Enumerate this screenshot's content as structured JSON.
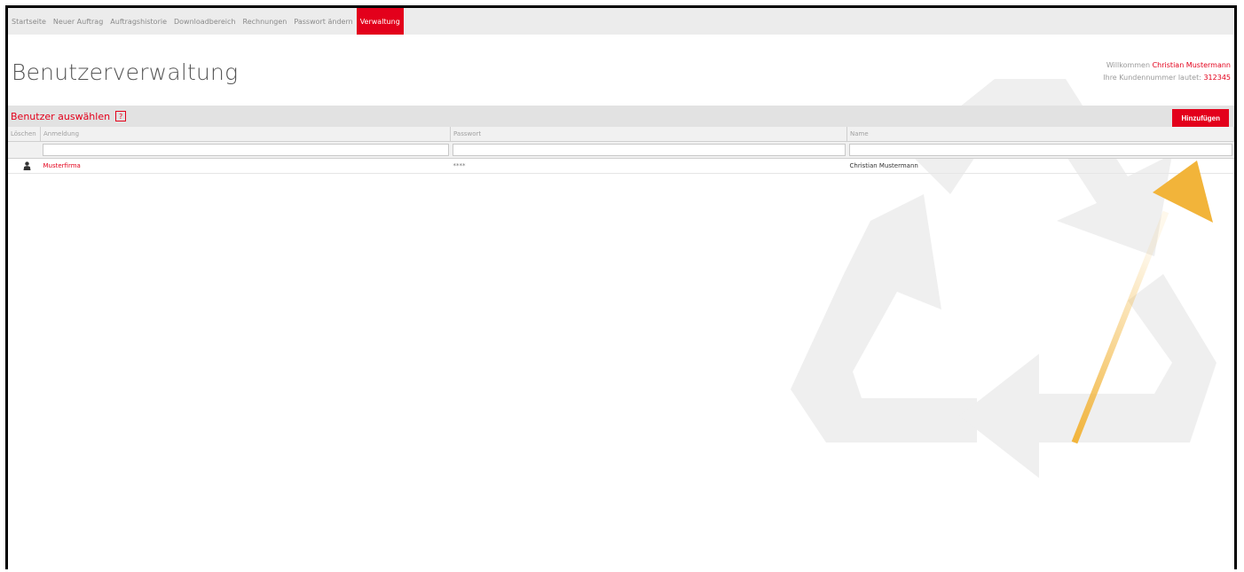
{
  "nav": {
    "items": [
      {
        "label": "Startseite"
      },
      {
        "label": "Neuer Auftrag"
      },
      {
        "label": "Auftragshistorie"
      },
      {
        "label": "Downloadbereich"
      },
      {
        "label": "Rechnungen"
      },
      {
        "label": "Passwort ändern"
      },
      {
        "label": "Verwaltung"
      }
    ],
    "active": "Verwaltung"
  },
  "page": {
    "title": "Benutzerverwaltung"
  },
  "welcome": {
    "prefix": "Willkommen",
    "user_name": "Christian Mustermann",
    "customer_prefix": "Ihre Kundennummer lautet:",
    "customer_number": "312345"
  },
  "section": {
    "title": "Benutzer auswählen",
    "help": "?",
    "add_label": "Hinzufügen"
  },
  "table": {
    "columns": [
      "Löschen",
      "Anmeldung",
      "Passwort",
      "Name"
    ],
    "rows": [
      {
        "login": "Musterfirma",
        "password": "****",
        "name": "Christian Mustermann"
      }
    ]
  },
  "colors": {
    "accent": "#e3001b",
    "nav_bg": "#ececec",
    "section_bg": "#e2e2e2",
    "annotation_arrow": "#f2b43a"
  },
  "icons": {
    "watermark": "recycle-icon",
    "row_icon": "user-icon",
    "annotation": "arrow-up-right-icon"
  }
}
